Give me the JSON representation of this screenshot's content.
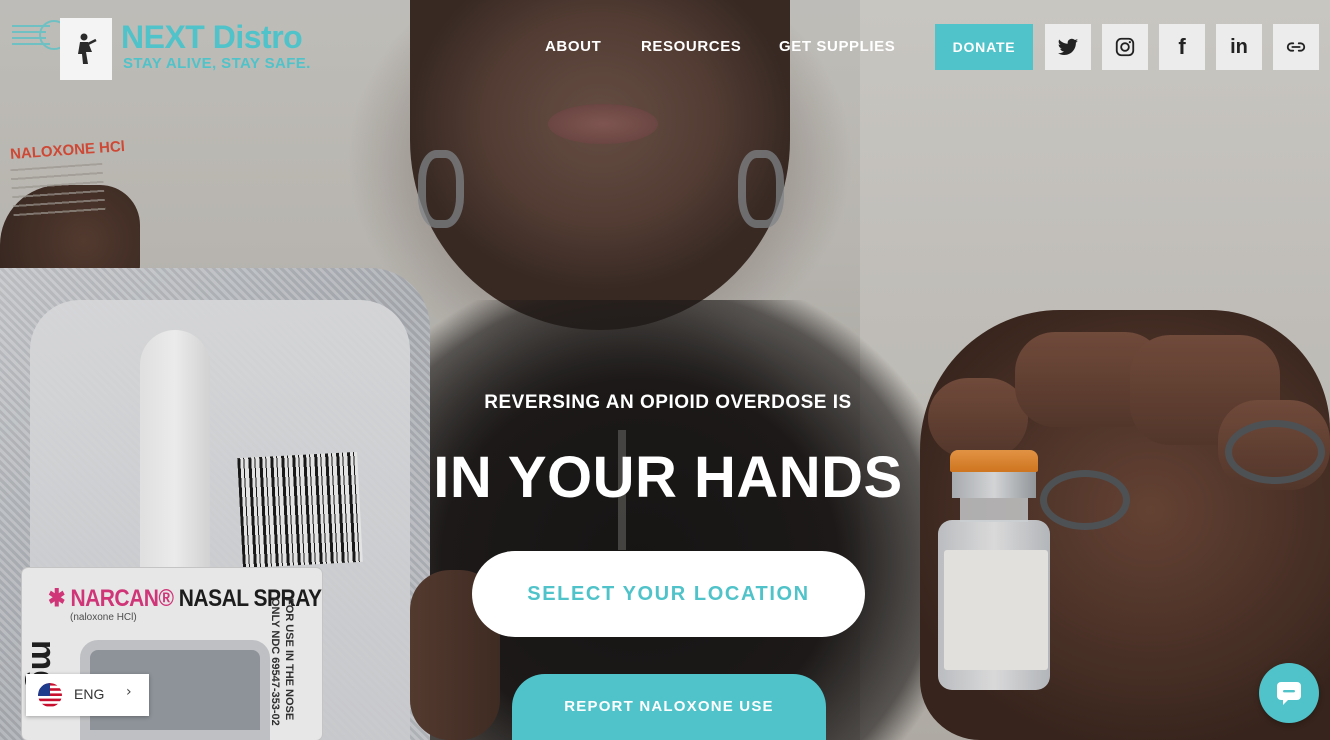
{
  "brand": {
    "name": "NEXT Distro",
    "tagline": "STAY ALIVE, STAY SAFE.",
    "accent_color": "#4fc3c9"
  },
  "nav": {
    "items": [
      {
        "label": "ABOUT"
      },
      {
        "label": "RESOURCES"
      },
      {
        "label": "GET SUPPLIES"
      }
    ],
    "donate_label": "DONATE"
  },
  "social": {
    "icons": [
      "twitter-icon",
      "instagram-icon",
      "facebook-icon",
      "linkedin-icon",
      "link-icon"
    ],
    "linkedin_text": "in",
    "facebook_text": "f"
  },
  "hero": {
    "eyebrow": "REVERSING AN OPIOID OVERDOSE IS",
    "headline": "IN YOUR HANDS",
    "primary_cta": "SELECT YOUR LOCATION",
    "secondary_cta": "REPORT NALOXONE USE"
  },
  "photo_text": {
    "narcan_brand": "NARCAN",
    "narcan_product": "NASAL SPRAY",
    "narcan_sub": "(naloxone HCl)",
    "narcan_mg": "mg",
    "narcan_side": "FOR USE IN THE NOSE ONLY NDC 69547-353-02",
    "vial_label": "NALOXONE HCl"
  },
  "language": {
    "code": "ENG",
    "chevron": "›",
    "flag_icon": "us-flag-icon"
  },
  "chat": {
    "icon": "chat-bubble-icon"
  }
}
